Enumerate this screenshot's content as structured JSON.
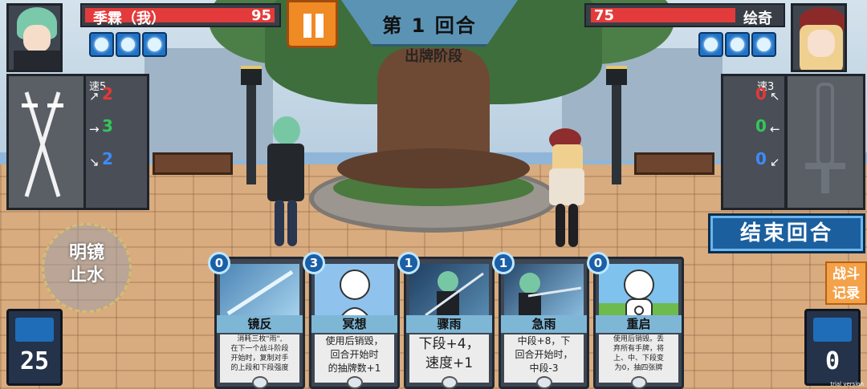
{
  "round": {
    "label": "第 1 回合",
    "phase": "出牌阶段"
  },
  "player": {
    "name": "季霖（我）",
    "hp": "95",
    "energy_count": 3,
    "speed_label": "速5",
    "stats": {
      "high": "2",
      "mid": "3",
      "low": "2"
    },
    "deck_count": "25",
    "skill": {
      "line1": "明镜",
      "line2": "止水"
    },
    "colors": {
      "high": "#e53935",
      "mid": "#34c759",
      "low": "#3d8bff"
    }
  },
  "opponent": {
    "name": "绘奇",
    "hp": "75",
    "energy_count": 3,
    "speed_label": "速3",
    "stats": {
      "high": "0",
      "mid": "0",
      "low": "0"
    },
    "deck_count": "0"
  },
  "buttons": {
    "end_turn": "结束回合",
    "battle_log_1": "战斗",
    "battle_log_2": "记录"
  },
  "cards": [
    {
      "cost": "0",
      "name": "镜反",
      "desc_lines": [
        "消耗三枚\"雨\",",
        "在下一个战斗阶段",
        "开始时，复制对手",
        "的上段和下段强度"
      ],
      "size": "small"
    },
    {
      "cost": "3",
      "name": "冥想",
      "desc_lines": [
        "使用后销毁，",
        "回合开始时",
        "的抽牌数+1"
      ],
      "size": "mid"
    },
    {
      "cost": "1",
      "name": "骤雨",
      "desc_lines": [
        "下段+4，",
        "速度+1"
      ],
      "size": "large"
    },
    {
      "cost": "1",
      "name": "急雨",
      "desc_lines": [
        "中段+8，下",
        "回合开始时，",
        "中段-3"
      ],
      "size": "mid"
    },
    {
      "cost": "0",
      "name": "重启",
      "desc_lines": [
        "使用后销毁。丢",
        "弃所有手牌，将",
        "上、中、下段变",
        "为0，抽四张牌"
      ],
      "size": "small"
    }
  ],
  "watermark": "trial version"
}
